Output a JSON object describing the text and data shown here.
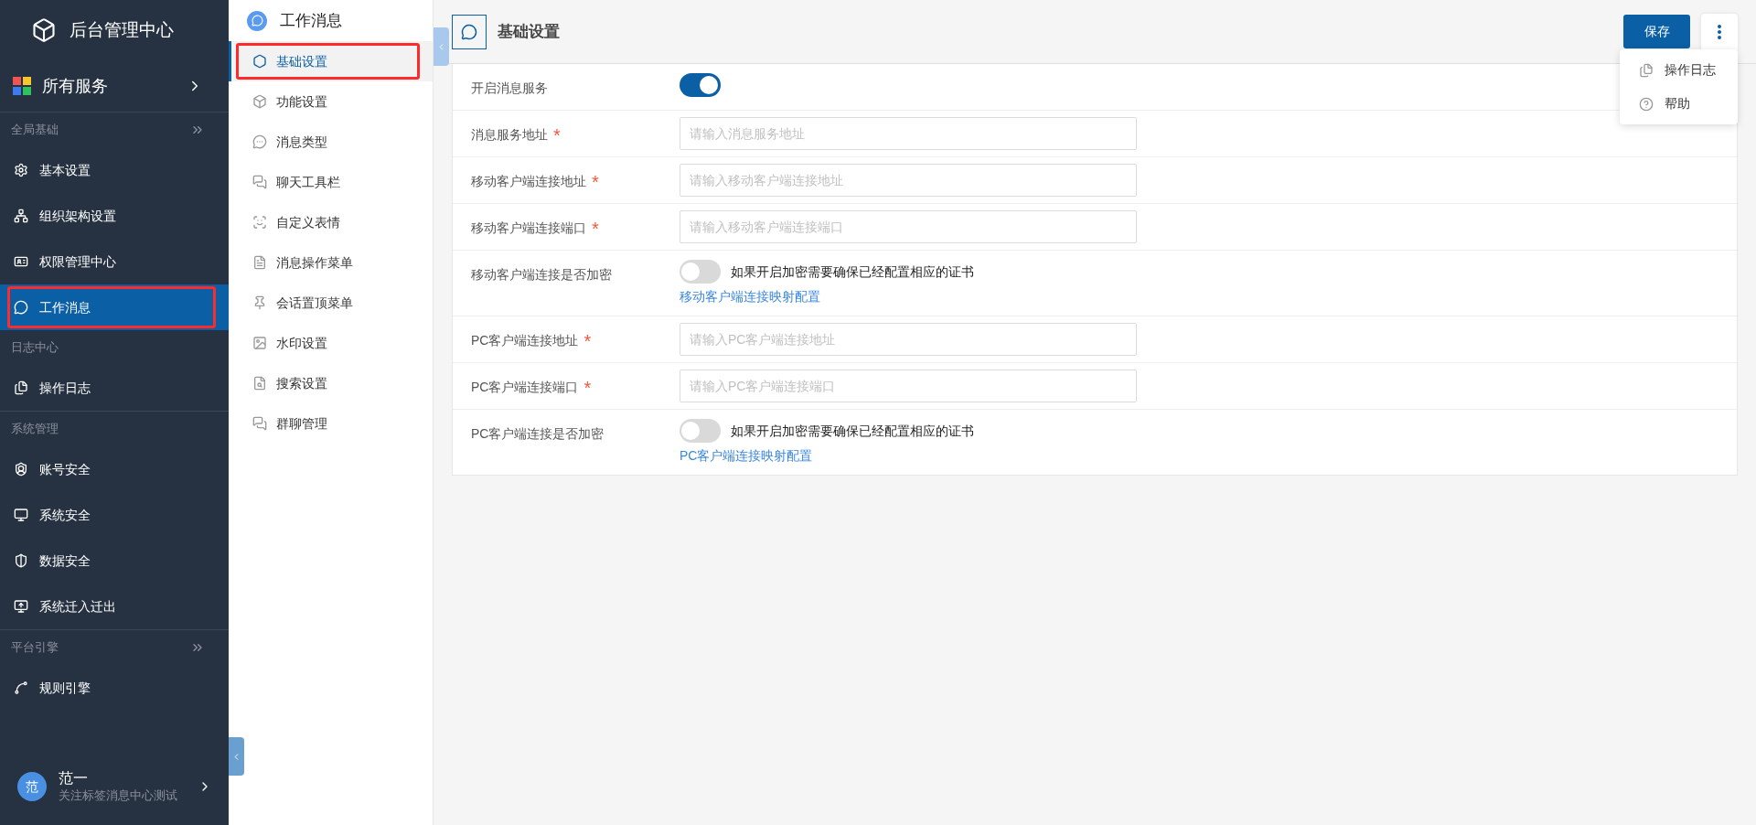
{
  "app": {
    "title": "后台管理中心"
  },
  "all_services": {
    "label": "所有服务"
  },
  "sidebar": {
    "groups": [
      {
        "title": "全局基础",
        "collapsible": true,
        "separated": true,
        "items": [
          {
            "label": "基本设置",
            "selected": false,
            "highlighted": false
          },
          {
            "label": "组织架构设置",
            "selected": false,
            "highlighted": false
          },
          {
            "label": "权限管理中心",
            "selected": false,
            "highlighted": false
          },
          {
            "label": "工作消息",
            "selected": true,
            "highlighted": true
          }
        ]
      },
      {
        "title": "日志中心",
        "collapsible": false,
        "separated": false,
        "items": [
          {
            "label": "操作日志",
            "selected": false,
            "highlighted": false
          }
        ]
      },
      {
        "title": "系统管理",
        "collapsible": false,
        "separated": true,
        "items": [
          {
            "label": "账号安全",
            "selected": false,
            "highlighted": false
          },
          {
            "label": "系统安全",
            "selected": false,
            "highlighted": false
          },
          {
            "label": "数据安全",
            "selected": false,
            "highlighted": false
          },
          {
            "label": "系统迁入迁出",
            "selected": false,
            "highlighted": false
          }
        ]
      },
      {
        "title": "平台引擎",
        "collapsible": true,
        "separated": true,
        "items": [
          {
            "label": "规则引擎",
            "selected": false,
            "highlighted": false
          }
        ]
      }
    ]
  },
  "user": {
    "avatar": "范",
    "name": "范一",
    "subtitle": "关注标签消息中心测试"
  },
  "submenu": {
    "title": "工作消息",
    "items": [
      {
        "label": "基础设置",
        "selected": true,
        "highlighted": true
      },
      {
        "label": "功能设置",
        "selected": false,
        "highlighted": false
      },
      {
        "label": "消息类型",
        "selected": false,
        "highlighted": false
      },
      {
        "label": "聊天工具栏",
        "selected": false,
        "highlighted": false
      },
      {
        "label": "自定义表情",
        "selected": false,
        "highlighted": false
      },
      {
        "label": "消息操作菜单",
        "selected": false,
        "highlighted": false
      },
      {
        "label": "会话置顶菜单",
        "selected": false,
        "highlighted": false
      },
      {
        "label": "水印设置",
        "selected": false,
        "highlighted": false
      },
      {
        "label": "搜索设置",
        "selected": false,
        "highlighted": false
      },
      {
        "label": "群聊管理",
        "selected": false,
        "highlighted": false
      }
    ]
  },
  "page": {
    "title": "基础设置",
    "save_button": "保存",
    "menu": {
      "open": true,
      "items": [
        "操作日志",
        "帮助"
      ]
    }
  },
  "form": {
    "rows": [
      {
        "kind": "switch",
        "label": "开启消息服务",
        "on": true
      },
      {
        "kind": "input",
        "label": "消息服务地址",
        "required_mark": "*",
        "placeholder": "请输入消息服务地址"
      },
      {
        "kind": "input",
        "label": "移动客户端连接地址",
        "required_mark": "*",
        "placeholder": "请输入移动客户端连接地址"
      },
      {
        "kind": "input",
        "label": "移动客户端连接端口",
        "required_mark": "*",
        "placeholder": "请输入移动客户端连接端口"
      },
      {
        "kind": "switch",
        "label": "移动客户端连接是否加密",
        "on": false,
        "note": "如果开启加密需要确保已经配置相应的证书",
        "link": "移动客户端连接映射配置"
      },
      {
        "kind": "input",
        "label": "PC客户端连接地址",
        "required_mark": "*",
        "placeholder": "请输入PC客户端连接地址"
      },
      {
        "kind": "input",
        "label": "PC客户端连接端口",
        "required_mark": "*",
        "placeholder": "请输入PC客户端连接端口"
      },
      {
        "kind": "switch",
        "label": "PC客户端连接是否加密",
        "on": false,
        "note": "如果开启加密需要确保已经配置相应的证书",
        "link": "PC客户端连接映射配置"
      }
    ]
  }
}
